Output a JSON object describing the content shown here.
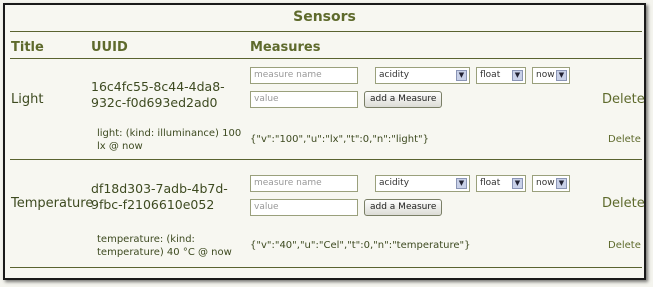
{
  "caption": "Sensors",
  "columns": {
    "title": "Title",
    "uuid": "UUID",
    "measures": "Measures"
  },
  "form": {
    "name_placeholder": "measure name",
    "value_placeholder": "value",
    "kind_selected": "acidity",
    "type_selected": "float",
    "time_selected": "now",
    "add_label": "add a Measure"
  },
  "rows": [
    {
      "title": "Light",
      "uuid": "16c4fc55-8c44-4da8-932c-f0d693ed2ad0",
      "delete_label": "Delete",
      "measure_summary": "light: (kind: illuminance) 100 lx @ now",
      "measure_json": "{\"v\":\"100\",\"u\":\"lx\",\"t\":0,\"n\":\"light\"}",
      "measure_delete": "Delete"
    },
    {
      "title": "Temperature",
      "uuid": "df18d303-7adb-4b7d-9fbc-f2106610e052",
      "delete_label": "Delete",
      "measure_summary": "temperature: (kind: temperature) 40 °C @ now",
      "measure_json": "{\"v\":\"40\",\"u\":\"Cel\",\"t\":0,\"n\":\"temperature\"}",
      "measure_delete": "Delete"
    }
  ]
}
